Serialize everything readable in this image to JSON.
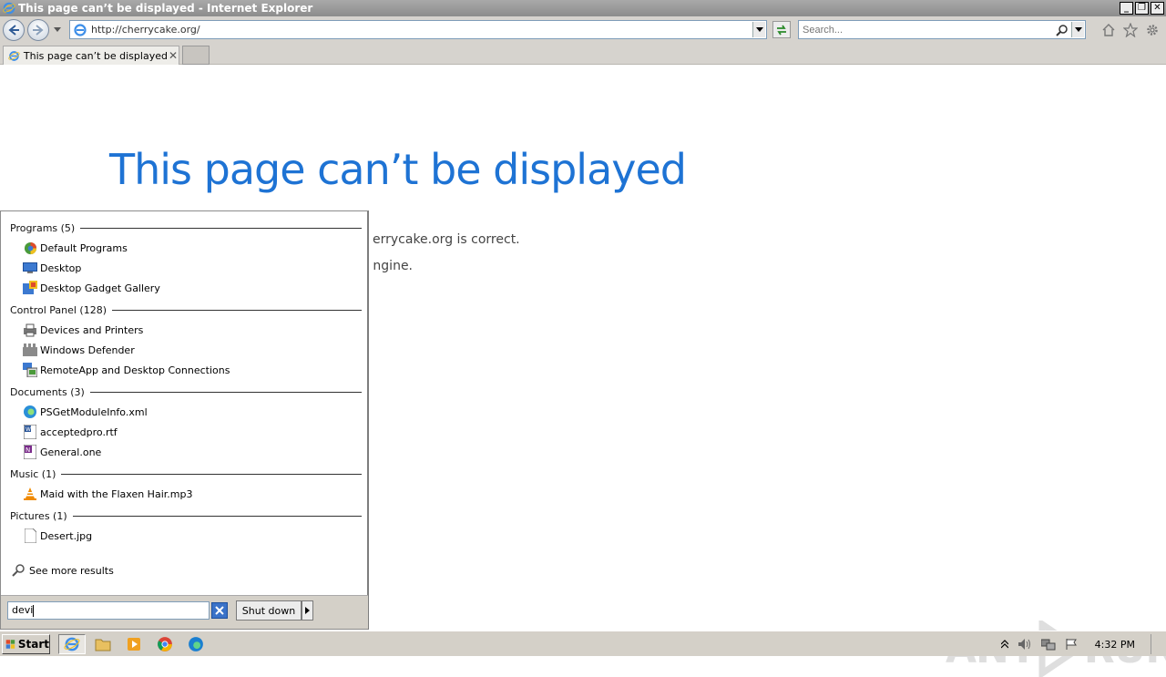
{
  "window": {
    "title": "This page can’t be displayed - Internet Explorer",
    "controls": {
      "minimize": "_",
      "restore": "❐",
      "close": "✕"
    }
  },
  "toolbar": {
    "address": "http://cherrycake.org/",
    "search_placeholder": "Search..."
  },
  "tabs": [
    {
      "label": "This page can’t be displayed",
      "close": "✕"
    }
  ],
  "page": {
    "title": "This page can’t be displayed",
    "line1_visible": "errycake.org is correct.",
    "line2_visible": "ngine."
  },
  "start_menu": {
    "groups": [
      {
        "label": "Programs (5)",
        "items": [
          "Default Programs",
          "Desktop",
          "Desktop Gadget Gallery"
        ]
      },
      {
        "label": "Control Panel (128)",
        "items": [
          "Devices and Printers",
          "Windows Defender",
          "RemoteApp and Desktop Connections"
        ]
      },
      {
        "label": "Documents (3)",
        "items": [
          "PSGetModuleInfo.xml",
          "acceptedpro.rtf",
          "General.one"
        ]
      },
      {
        "label": "Music (1)",
        "items": [
          "Maid with the Flaxen Hair.mp3"
        ]
      },
      {
        "label": "Pictures (1)",
        "items": [
          "Desert.jpg"
        ]
      }
    ],
    "see_more": "See more results",
    "search_value": "devi",
    "shutdown_label": "Shut down"
  },
  "taskbar": {
    "start_label": "Start",
    "clock": "4:32 PM"
  },
  "watermark": {
    "text_left": "ANY",
    "text_right": "RUN"
  },
  "colors": {
    "title_blue": "#1e73d4",
    "titlebar": "#9a9a9a"
  }
}
